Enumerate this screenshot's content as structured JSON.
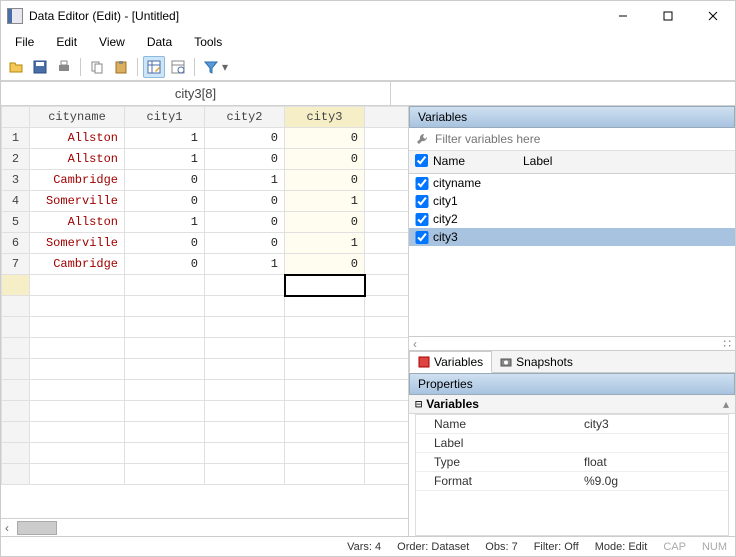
{
  "window": {
    "title": "Data Editor (Edit) - [Untitled]"
  },
  "menu": [
    "File",
    "Edit",
    "View",
    "Data",
    "Tools"
  ],
  "toolbar_icons": [
    "open-icon",
    "save-icon",
    "print-icon",
    "copy-icon",
    "paste-icon",
    "grid-edit-icon",
    "grid-browse-icon",
    "filter-icon"
  ],
  "cellref": "city3[8]",
  "columns": [
    {
      "name": "cityname",
      "selected": false
    },
    {
      "name": "city1",
      "selected": false
    },
    {
      "name": "city2",
      "selected": false
    },
    {
      "name": "city3",
      "selected": true
    }
  ],
  "rows": [
    {
      "n": "1",
      "cityname": "Allston",
      "city1": "1",
      "city2": "0",
      "city3": "0"
    },
    {
      "n": "2",
      "cityname": "Allston",
      "city1": "1",
      "city2": "0",
      "city3": "0"
    },
    {
      "n": "3",
      "cityname": "Cambridge",
      "city1": "0",
      "city2": "1",
      "city3": "0"
    },
    {
      "n": "4",
      "cityname": "Somerville",
      "city1": "0",
      "city2": "0",
      "city3": "1"
    },
    {
      "n": "5",
      "cityname": "Allston",
      "city1": "1",
      "city2": "0",
      "city3": "0"
    },
    {
      "n": "6",
      "cityname": "Somerville",
      "city1": "0",
      "city2": "0",
      "city3": "1"
    },
    {
      "n": "7",
      "cityname": "Cambridge",
      "city1": "0",
      "city2": "1",
      "city3": "0"
    }
  ],
  "vars_panel": {
    "title": "Variables",
    "filter_placeholder": "Filter variables here",
    "head_name": "Name",
    "head_label": "Label",
    "items": [
      {
        "name": "cityname",
        "checked": true,
        "selected": false
      },
      {
        "name": "city1",
        "checked": true,
        "selected": false
      },
      {
        "name": "city2",
        "checked": true,
        "selected": false
      },
      {
        "name": "city3",
        "checked": true,
        "selected": true
      }
    ]
  },
  "tabs": {
    "variables": "Variables",
    "snapshots": "Snapshots"
  },
  "properties": {
    "title": "Properties",
    "subtitle": "Variables",
    "rows": [
      {
        "name": "Name",
        "value": "city3"
      },
      {
        "name": "Label",
        "value": ""
      },
      {
        "name": "Type",
        "value": "float"
      },
      {
        "name": "Format",
        "value": "%9.0g"
      }
    ]
  },
  "status": {
    "vars": "Vars: 4",
    "order": "Order: Dataset",
    "obs": "Obs: 7",
    "filter": "Filter: Off",
    "mode": "Mode: Edit",
    "cap": "CAP",
    "num": "NUM"
  }
}
